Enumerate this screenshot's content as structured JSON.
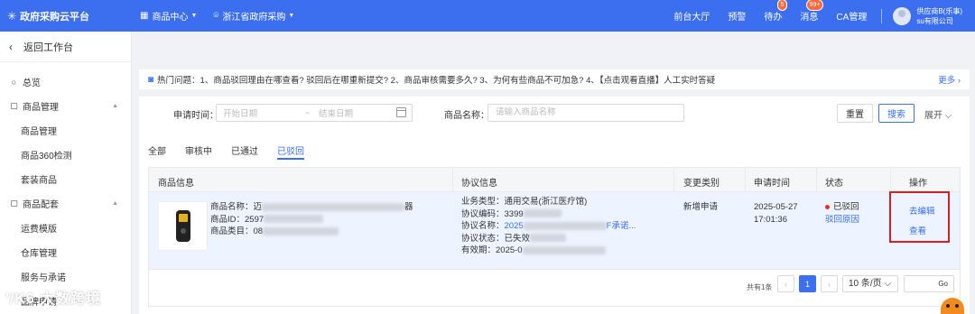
{
  "colors": {
    "primary": "#3b6ff0",
    "highlight_box": "#d81e1e",
    "status_dot": "#e0342b"
  },
  "topbar": {
    "logo_icon": "snowflake-icon",
    "brand": "政府采购云平台",
    "nav": [
      {
        "icon": "grid-icon",
        "label": "商品中心"
      },
      {
        "icon": "location-icon",
        "label": "浙江省政府采购"
      }
    ],
    "links": {
      "front_hall": "前台大厅",
      "alert": "预警",
      "todo": "待办",
      "todo_badge": "5",
      "message": "消息",
      "message_badge": "99+",
      "ca": "CA管理"
    },
    "user": {
      "name": "供应商B(乐事)",
      "company": "su有限公司"
    }
  },
  "sidebar": {
    "back": "返回工作台",
    "items": [
      {
        "label": "总览",
        "icon": "circle-icon"
      },
      {
        "label": "商品管理",
        "icon": "box-icon",
        "expandable": true
      },
      {
        "label": "商品管理",
        "sub": true
      },
      {
        "label": "商品360检测",
        "sub": true
      },
      {
        "label": "套装商品",
        "sub": true
      },
      {
        "label": "商品配套",
        "icon": "box-icon",
        "expandable": true
      },
      {
        "label": "运费模版",
        "sub": true
      },
      {
        "label": "仓库管理",
        "sub": true
      },
      {
        "label": "服务与承诺",
        "sub": true
      },
      {
        "label": "品牌申请",
        "sub": true
      }
    ]
  },
  "notice": {
    "icon": "chat-icon",
    "text": "热门问题：1、商品驳回理由在哪查看? 驳回后在哪重新提交? 2、商品审核需要多久? 3、为何有些商品不可加急? 4、【点击观看直播】人工实时答疑",
    "more": "更多 ›"
  },
  "filter": {
    "date_label": "申请时间：",
    "start_placeholder": "开始日期",
    "separator": "~",
    "end_placeholder": "结束日期",
    "name_label": "商品名称：",
    "name_placeholder": "请输入商品名称",
    "reset": "重置",
    "search": "搜索",
    "expand": "展开 ⌵"
  },
  "tabs": [
    "全部",
    "审核中",
    "已通过",
    "已驳回"
  ],
  "table": {
    "headers": [
      "商品信息",
      "协议信息",
      "变更类别",
      "申请时间",
      "状态",
      "操作"
    ],
    "row": {
      "product_name_label": "商品名称：",
      "product_name_value": "迈",
      "product_name_tail": "器",
      "product_id_label": "商品ID：",
      "product_id_value": "2597",
      "product_category_label": "商品类目：",
      "product_category_value": "08",
      "agreement_type": "业务类型：通用交易(浙江医疗馆)",
      "agreement_code": "协议编码：3399",
      "agreement_name_label": "协议名称：",
      "agreement_name_link": "2025",
      "agreement_name_tail": "F承诺...",
      "agreement_status": "协议状态：已失效",
      "agreement_validity": "有效期：2025-0",
      "change_type": "新增申请",
      "apply_date": "2025-05-27",
      "apply_time": "17:01:36",
      "status": "已驳回",
      "reject_reason": "驳回原因",
      "actions": {
        "edit": "去编辑",
        "view": "查看"
      }
    }
  },
  "pagination": {
    "total": "共有1条",
    "prev": "‹",
    "current": "1",
    "next": "›",
    "page_size": "10 条/页 ⌵",
    "go": "Go"
  },
  "watermark": "'/K6 大数跨境"
}
